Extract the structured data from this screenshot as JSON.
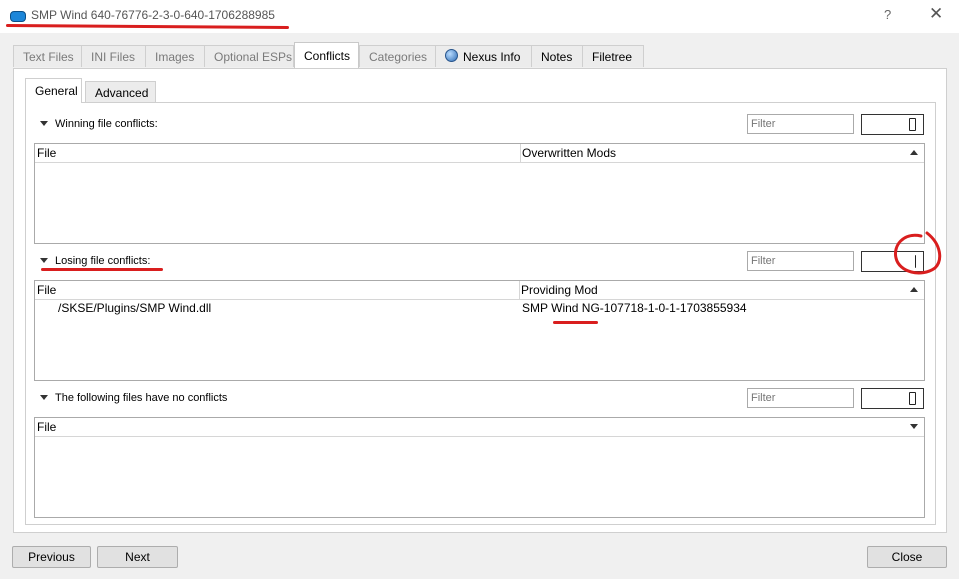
{
  "window": {
    "title": "SMP Wind 640-76776-2-3-0-640-1706288985",
    "help_glyph": "?",
    "close_glyph": "✕"
  },
  "tabs": [
    {
      "label": "Text Files"
    },
    {
      "label": "INI Files"
    },
    {
      "label": "Images"
    },
    {
      "label": "Optional ESPs"
    },
    {
      "label": "Conflicts"
    },
    {
      "label": "Categories"
    },
    {
      "label": "Nexus Info"
    },
    {
      "label": "Notes"
    },
    {
      "label": "Filetree"
    }
  ],
  "subtabs": [
    {
      "label": "General"
    },
    {
      "label": "Advanced"
    }
  ],
  "sections": {
    "winning": {
      "title": "Winning file conflicts:",
      "filter_placeholder": "Filter",
      "count": 0,
      "columns": [
        "File",
        "Overwritten Mods"
      ],
      "rows": []
    },
    "losing": {
      "title": "Losing file conflicts:",
      "filter_placeholder": "Filter",
      "count": 1,
      "columns": [
        "File",
        "Providing Mod"
      ],
      "rows": [
        {
          "file": "/SKSE/Plugins/SMP Wind.dll",
          "mod": "SMP Wind NG-107718-1-0-1-1703855934"
        }
      ]
    },
    "noconflict": {
      "title": "The following files have no conflicts",
      "filter_placeholder": "Filter",
      "count": 0,
      "columns": [
        "File"
      ],
      "rows": []
    }
  },
  "footer": {
    "previous": "Previous",
    "next": "Next",
    "close": "Close"
  },
  "colors": {
    "annotation": "#d91e1e",
    "accent": "#1c86d9"
  }
}
